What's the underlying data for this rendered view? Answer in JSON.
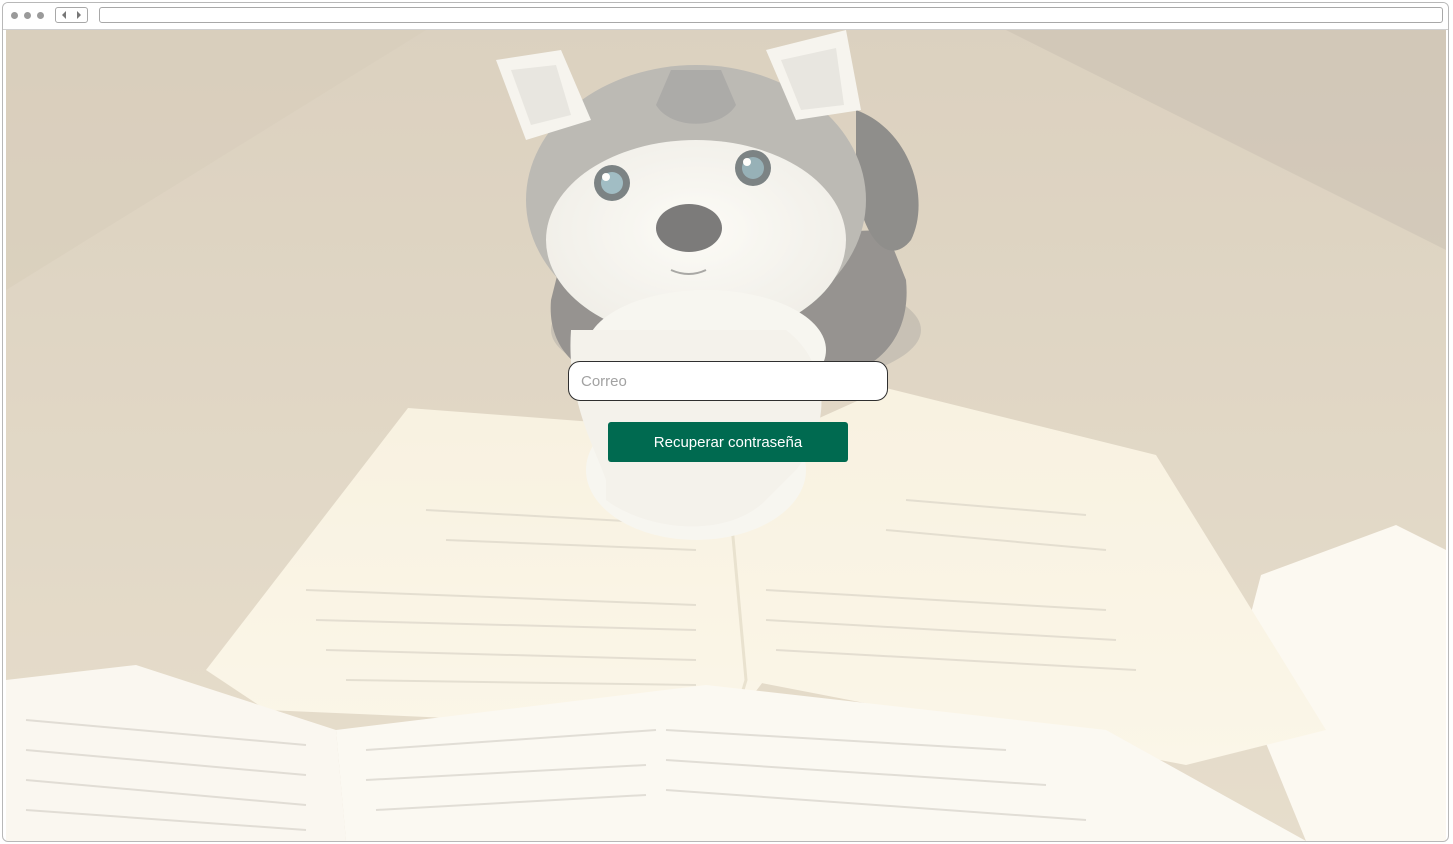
{
  "form": {
    "email_placeholder": "Correo",
    "email_value": "",
    "submit_label": "Recuperar contraseña"
  },
  "colors": {
    "primary_button": "#006a50",
    "overlay_tint": "#fffdf5"
  },
  "icons": {
    "back": "chevron-left-icon",
    "forward": "chevron-right-icon"
  }
}
